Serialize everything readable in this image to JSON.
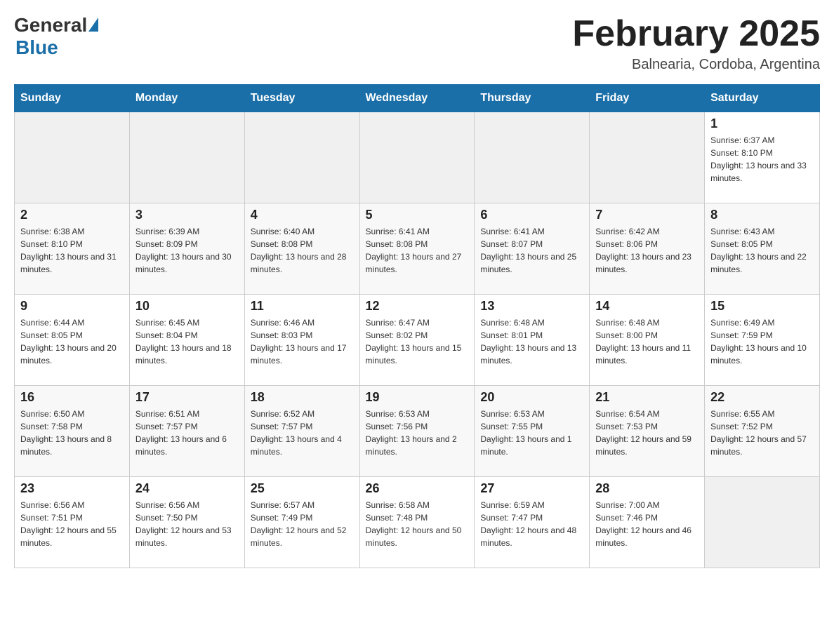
{
  "header": {
    "logo_general": "General",
    "logo_blue": "Blue",
    "month_title": "February 2025",
    "location": "Balnearia, Cordoba, Argentina"
  },
  "weekdays": [
    "Sunday",
    "Monday",
    "Tuesday",
    "Wednesday",
    "Thursday",
    "Friday",
    "Saturday"
  ],
  "weeks": [
    [
      {
        "day": "",
        "info": ""
      },
      {
        "day": "",
        "info": ""
      },
      {
        "day": "",
        "info": ""
      },
      {
        "day": "",
        "info": ""
      },
      {
        "day": "",
        "info": ""
      },
      {
        "day": "",
        "info": ""
      },
      {
        "day": "1",
        "info": "Sunrise: 6:37 AM\nSunset: 8:10 PM\nDaylight: 13 hours and 33 minutes."
      }
    ],
    [
      {
        "day": "2",
        "info": "Sunrise: 6:38 AM\nSunset: 8:10 PM\nDaylight: 13 hours and 31 minutes."
      },
      {
        "day": "3",
        "info": "Sunrise: 6:39 AM\nSunset: 8:09 PM\nDaylight: 13 hours and 30 minutes."
      },
      {
        "day": "4",
        "info": "Sunrise: 6:40 AM\nSunset: 8:08 PM\nDaylight: 13 hours and 28 minutes."
      },
      {
        "day": "5",
        "info": "Sunrise: 6:41 AM\nSunset: 8:08 PM\nDaylight: 13 hours and 27 minutes."
      },
      {
        "day": "6",
        "info": "Sunrise: 6:41 AM\nSunset: 8:07 PM\nDaylight: 13 hours and 25 minutes."
      },
      {
        "day": "7",
        "info": "Sunrise: 6:42 AM\nSunset: 8:06 PM\nDaylight: 13 hours and 23 minutes."
      },
      {
        "day": "8",
        "info": "Sunrise: 6:43 AM\nSunset: 8:05 PM\nDaylight: 13 hours and 22 minutes."
      }
    ],
    [
      {
        "day": "9",
        "info": "Sunrise: 6:44 AM\nSunset: 8:05 PM\nDaylight: 13 hours and 20 minutes."
      },
      {
        "day": "10",
        "info": "Sunrise: 6:45 AM\nSunset: 8:04 PM\nDaylight: 13 hours and 18 minutes."
      },
      {
        "day": "11",
        "info": "Sunrise: 6:46 AM\nSunset: 8:03 PM\nDaylight: 13 hours and 17 minutes."
      },
      {
        "day": "12",
        "info": "Sunrise: 6:47 AM\nSunset: 8:02 PM\nDaylight: 13 hours and 15 minutes."
      },
      {
        "day": "13",
        "info": "Sunrise: 6:48 AM\nSunset: 8:01 PM\nDaylight: 13 hours and 13 minutes."
      },
      {
        "day": "14",
        "info": "Sunrise: 6:48 AM\nSunset: 8:00 PM\nDaylight: 13 hours and 11 minutes."
      },
      {
        "day": "15",
        "info": "Sunrise: 6:49 AM\nSunset: 7:59 PM\nDaylight: 13 hours and 10 minutes."
      }
    ],
    [
      {
        "day": "16",
        "info": "Sunrise: 6:50 AM\nSunset: 7:58 PM\nDaylight: 13 hours and 8 minutes."
      },
      {
        "day": "17",
        "info": "Sunrise: 6:51 AM\nSunset: 7:57 PM\nDaylight: 13 hours and 6 minutes."
      },
      {
        "day": "18",
        "info": "Sunrise: 6:52 AM\nSunset: 7:57 PM\nDaylight: 13 hours and 4 minutes."
      },
      {
        "day": "19",
        "info": "Sunrise: 6:53 AM\nSunset: 7:56 PM\nDaylight: 13 hours and 2 minutes."
      },
      {
        "day": "20",
        "info": "Sunrise: 6:53 AM\nSunset: 7:55 PM\nDaylight: 13 hours and 1 minute."
      },
      {
        "day": "21",
        "info": "Sunrise: 6:54 AM\nSunset: 7:53 PM\nDaylight: 12 hours and 59 minutes."
      },
      {
        "day": "22",
        "info": "Sunrise: 6:55 AM\nSunset: 7:52 PM\nDaylight: 12 hours and 57 minutes."
      }
    ],
    [
      {
        "day": "23",
        "info": "Sunrise: 6:56 AM\nSunset: 7:51 PM\nDaylight: 12 hours and 55 minutes."
      },
      {
        "day": "24",
        "info": "Sunrise: 6:56 AM\nSunset: 7:50 PM\nDaylight: 12 hours and 53 minutes."
      },
      {
        "day": "25",
        "info": "Sunrise: 6:57 AM\nSunset: 7:49 PM\nDaylight: 12 hours and 52 minutes."
      },
      {
        "day": "26",
        "info": "Sunrise: 6:58 AM\nSunset: 7:48 PM\nDaylight: 12 hours and 50 minutes."
      },
      {
        "day": "27",
        "info": "Sunrise: 6:59 AM\nSunset: 7:47 PM\nDaylight: 12 hours and 48 minutes."
      },
      {
        "day": "28",
        "info": "Sunrise: 7:00 AM\nSunset: 7:46 PM\nDaylight: 12 hours and 46 minutes."
      },
      {
        "day": "",
        "info": ""
      }
    ]
  ]
}
